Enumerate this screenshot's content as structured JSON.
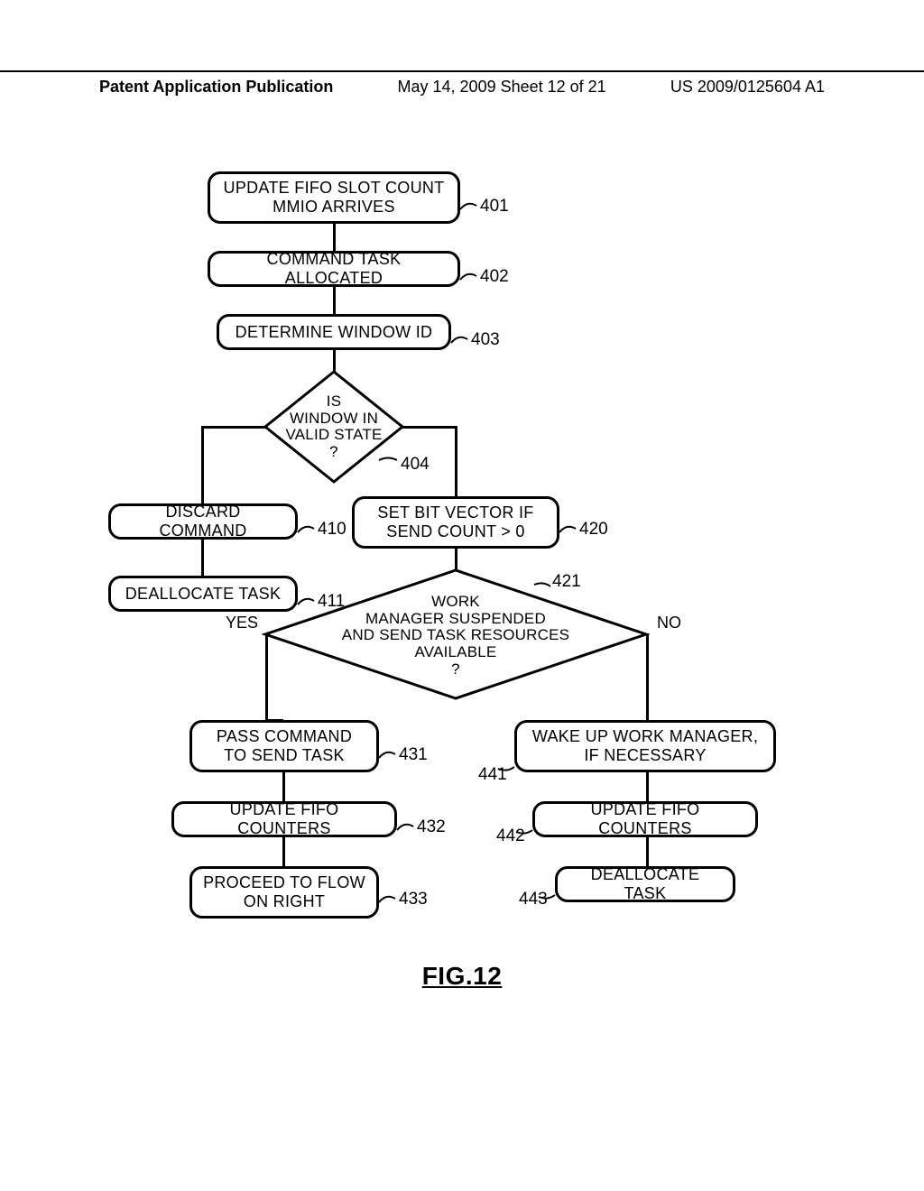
{
  "header": {
    "left": "Patent Application Publication",
    "center": "May 14, 2009  Sheet 12 of 21",
    "right": "US 2009/0125604 A1"
  },
  "boxes": {
    "b401": "UPDATE FIFO SLOT COUNT\nMMIO ARRIVES",
    "b402": "COMMAND TASK ALLOCATED",
    "b403": "DETERMINE WINDOW ID",
    "b410": "DISCARD COMMAND",
    "b411": "DEALLOCATE TASK",
    "b420": "SET BIT VECTOR IF\nSEND COUNT > 0",
    "b431": "PASS COMMAND\nTO SEND TASK",
    "b432": "UPDATE FIFO COUNTERS",
    "b433": "PROCEED TO FLOW\nON RIGHT",
    "b441": "WAKE UP WORK MANAGER,\nIF NECESSARY",
    "b442": "UPDATE FIFO COUNTERS",
    "b443": "DEALLOCATE TASK"
  },
  "diamonds": {
    "d404": "IS\nWINDOW IN\nVALID STATE\n?",
    "d421": "WORK\nMANAGER SUSPENDED\nAND SEND TASK RESOURCES\nAVAILABLE\n?"
  },
  "refs": {
    "r401": "401",
    "r402": "402",
    "r403": "403",
    "r404": "404",
    "r410": "410",
    "r411": "411",
    "r420": "420",
    "r421": "421",
    "r431": "431",
    "r432": "432",
    "r433": "433",
    "r441": "441",
    "r442": "442",
    "r443": "443"
  },
  "labels": {
    "yes": "YES",
    "no": "NO"
  },
  "figure": "FIG.12"
}
